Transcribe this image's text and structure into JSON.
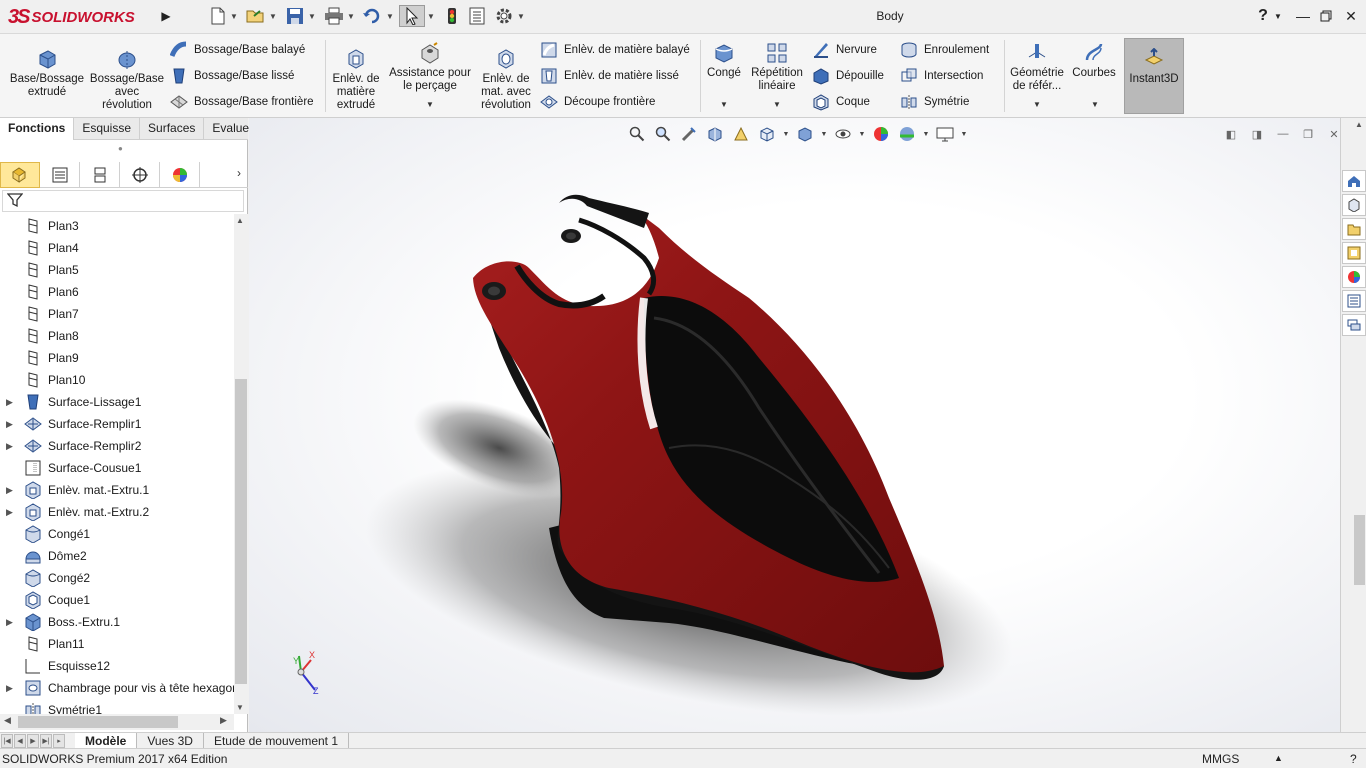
{
  "app": {
    "logo_mark": "3S",
    "logo_text": "SOLIDWORKS",
    "document_title": "Body",
    "help_label": "?"
  },
  "icons": {
    "new": "new-document-icon",
    "open": "open-icon",
    "save": "save-icon",
    "print": "print-icon",
    "undo": "undo-icon",
    "select": "select-pointer-icon",
    "rebuild": "rebuild-traffic-light-icon",
    "file_props": "file-properties-icon",
    "options": "gear-icon"
  },
  "ribbon": {
    "extrude_boss": "Base/Bossage extrudé",
    "revolve_boss_l1": "Bossage/Base",
    "revolve_boss_l2": "avec",
    "revolve_boss_l3": "révolution",
    "swept_boss": "Bossage/Base balayé",
    "lofted_boss": "Bossage/Base lissé",
    "boundary_boss": "Bossage/Base frontière",
    "extruded_cut_l1": "Enlèv. de",
    "extruded_cut_l2": "matière",
    "extruded_cut_l3": "extrudé",
    "hole_wizard_l1": "Assistance pour",
    "hole_wizard_l2": "le perçage",
    "revolved_cut_l1": "Enlèv. de",
    "revolved_cut_l2": "mat. avec",
    "revolved_cut_l3": "révolution",
    "swept_cut": "Enlèv. de matière balayé",
    "lofted_cut": "Enlèv. de matière lissé",
    "boundary_cut": "Découpe frontière",
    "fillet": "Congé",
    "linear_pattern_l1": "Répétition",
    "linear_pattern_l2": "linéaire",
    "rib": "Nervure",
    "draft": "Dépouille",
    "shell": "Coque",
    "wrap": "Enroulement",
    "intersect": "Intersection",
    "mirror": "Symétrie",
    "ref_geometry_l1": "Géométrie",
    "ref_geometry_l2": "de référ...",
    "curves": "Courbes",
    "instant3d": "Instant3D"
  },
  "cm_tabs": [
    "Fonctions",
    "Esquisse",
    "Surfaces",
    "Evaluer"
  ],
  "tree": [
    {
      "label": "Plan3",
      "icon": "plane-icon",
      "expandable": false
    },
    {
      "label": "Plan4",
      "icon": "plane-icon",
      "expandable": false
    },
    {
      "label": "Plan5",
      "icon": "plane-icon",
      "expandable": false
    },
    {
      "label": "Plan6",
      "icon": "plane-icon",
      "expandable": false
    },
    {
      "label": "Plan7",
      "icon": "plane-icon",
      "expandable": false
    },
    {
      "label": "Plan8",
      "icon": "plane-icon",
      "expandable": false
    },
    {
      "label": "Plan9",
      "icon": "plane-icon",
      "expandable": false
    },
    {
      "label": "Plan10",
      "icon": "plane-icon",
      "expandable": false
    },
    {
      "label": "Surface-Lissage1",
      "icon": "surface-loft-icon",
      "expandable": true
    },
    {
      "label": "Surface-Remplir1",
      "icon": "surface-fill-icon",
      "expandable": true
    },
    {
      "label": "Surface-Remplir2",
      "icon": "surface-fill-icon",
      "expandable": true
    },
    {
      "label": "Surface-Cousue1",
      "icon": "surface-knit-icon",
      "expandable": false
    },
    {
      "label": "Enlèv. mat.-Extru.1",
      "icon": "cut-extrude-icon",
      "expandable": true
    },
    {
      "label": "Enlèv. mat.-Extru.2",
      "icon": "cut-extrude-icon",
      "expandable": true
    },
    {
      "label": "Congé1",
      "icon": "fillet-icon",
      "expandable": false
    },
    {
      "label": "Dôme2",
      "icon": "dome-icon",
      "expandable": false
    },
    {
      "label": "Congé2",
      "icon": "fillet-icon",
      "expandable": false
    },
    {
      "label": "Coque1",
      "icon": "shell-icon",
      "expandable": false
    },
    {
      "label": "Boss.-Extru.1",
      "icon": "boss-extrude-icon",
      "expandable": true
    },
    {
      "label": "Plan11",
      "icon": "plane-icon",
      "expandable": false
    },
    {
      "label": "Esquisse12",
      "icon": "sketch-icon",
      "expandable": false
    },
    {
      "label": "Chambrage pour vis à tête hexagon",
      "icon": "hole-icon",
      "expandable": true
    },
    {
      "label": "Symétrie1",
      "icon": "mirror-icon",
      "expandable": false
    }
  ],
  "triad": {
    "x": "X",
    "y": "Y",
    "z": "Z"
  },
  "bottom_tabs": [
    "Modèle",
    "Vues 3D",
    "Etude de mouvement 1"
  ],
  "status": {
    "product": "SOLIDWORKS Premium 2017 x64 Edition",
    "units": "MMGS",
    "help": "?"
  },
  "colors": {
    "body_red": "#8e1515",
    "body_black": "#111111",
    "brand_red": "#c8102e",
    "instant3d_active": "#b9b9b9"
  }
}
